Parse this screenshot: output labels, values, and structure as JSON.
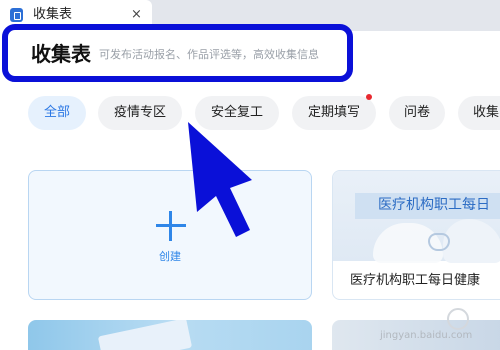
{
  "tab": {
    "title": "收集表",
    "close": "×"
  },
  "header": {
    "title": "收集表",
    "subtitle": "可发布活动报名、作品评选等，高效收集信息"
  },
  "filters": [
    {
      "label": "全部",
      "active": true
    },
    {
      "label": "疫情专区",
      "active": false
    },
    {
      "label": "安全复工",
      "active": false
    },
    {
      "label": "定期填写",
      "active": false,
      "badge": true
    },
    {
      "label": "问卷",
      "active": false
    },
    {
      "label": "收集",
      "active": false
    }
  ],
  "create_card": {
    "label": "创建"
  },
  "template_card": {
    "banner_text": "医疗机构职工每日",
    "label": "医疗机构职工每日健康"
  },
  "watermark": "jingyan.baidu.com",
  "colors": {
    "accent": "#2c78e4",
    "highlight_border": "#0a10d8",
    "arrow": "#0a10d8",
    "badge": "#e8292f"
  },
  "icons": [
    "document-icon",
    "close-icon",
    "plus-icon",
    "pointer-arrow"
  ]
}
